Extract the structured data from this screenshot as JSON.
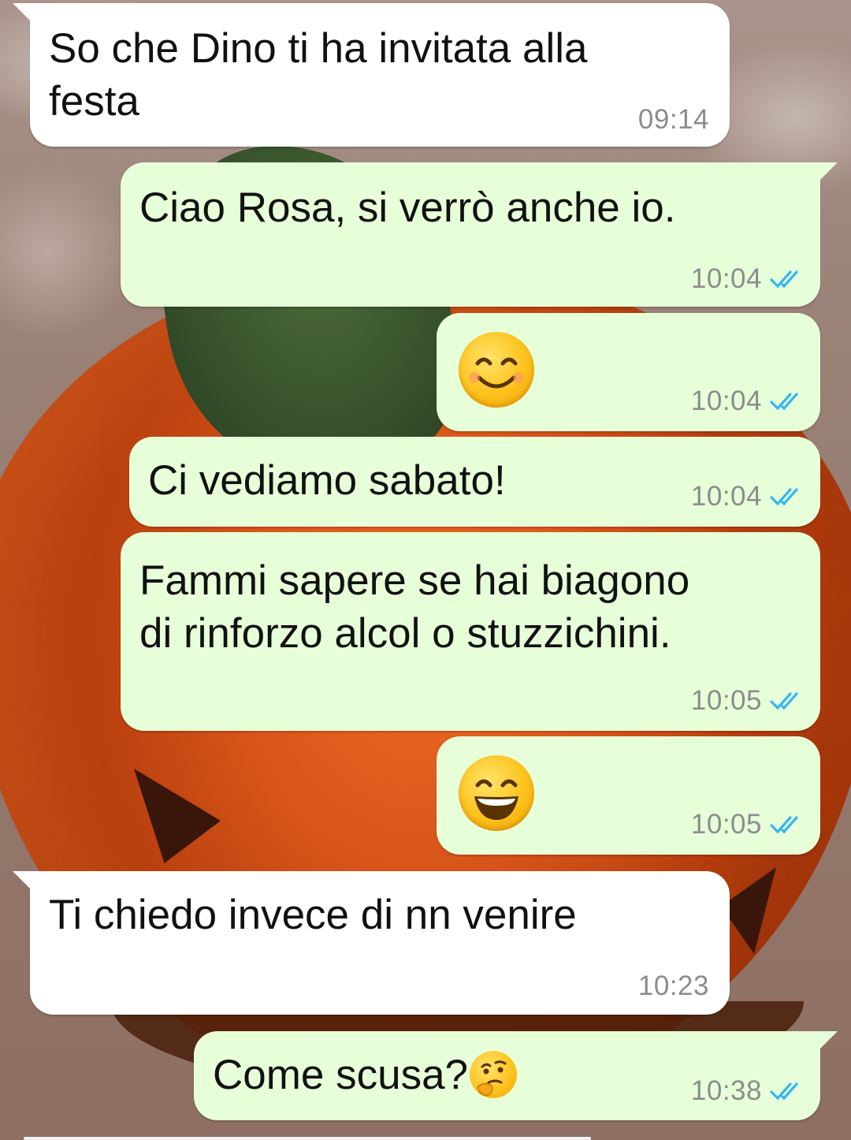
{
  "messages": [
    {
      "direction": "in",
      "text": "So che Dino ti ha invitata alla\nfesta",
      "time": "09:14"
    },
    {
      "direction": "out",
      "text": "Ciao Rosa, si verrò anche io.",
      "time": "10:04"
    },
    {
      "direction": "out",
      "emoji": "smiling-face-with-smiling-eyes",
      "time": "10:04"
    },
    {
      "direction": "out",
      "text": "Ci vediamo sabato!",
      "time": "10:04"
    },
    {
      "direction": "out",
      "text": "Fammi sapere se hai biagono\ndi rinforzo alcol o stuzzichini.",
      "time": "10:05"
    },
    {
      "direction": "out",
      "emoji": "grinning-face-with-smiling-eyes",
      "time": "10:05"
    },
    {
      "direction": "in",
      "text": "Ti chiedo invece di nn venire",
      "time": "10:23"
    },
    {
      "direction": "out",
      "text": "Come scusa?",
      "emoji": "thinking-face",
      "time": "10:38"
    }
  ],
  "colors": {
    "incoming_bubble": "#ffffff",
    "outgoing_bubble": "#e7ffd9",
    "read_ticks": "#34b7f1",
    "timestamp": "#8c8c8c"
  },
  "status_icon": "double-check-read-icon"
}
